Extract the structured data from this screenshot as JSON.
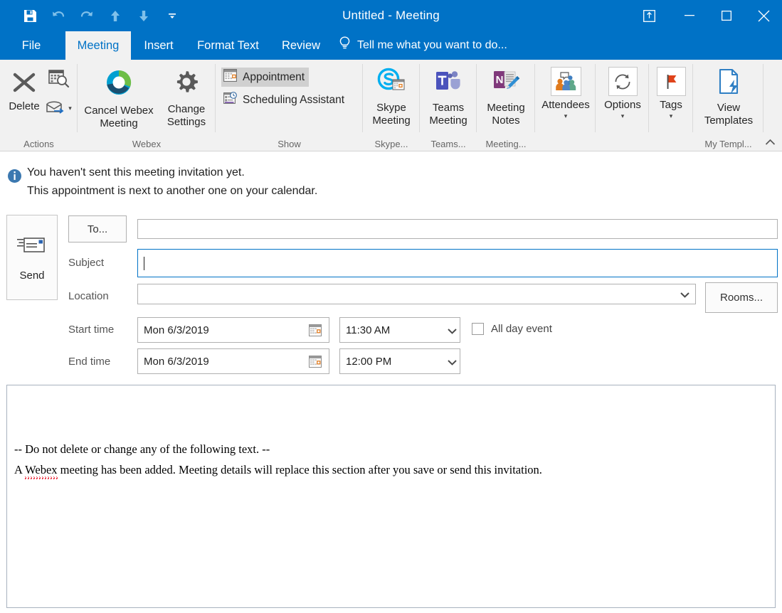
{
  "window": {
    "title": "Untitled - Meeting",
    "quick_access": [
      {
        "name": "save-icon",
        "label": "Save"
      },
      {
        "name": "undo-icon",
        "label": "Undo"
      },
      {
        "name": "redo-icon",
        "label": "Redo"
      },
      {
        "name": "previous-item-icon",
        "label": "Previous Item"
      },
      {
        "name": "next-item-icon",
        "label": "Next Item"
      },
      {
        "name": "customize-quick-access-toolbar-icon",
        "label": "Customize Quick Access Toolbar"
      }
    ],
    "controls": [
      {
        "name": "pin-ribbon-button",
        "label": "Ribbon Display Options"
      },
      {
        "name": "minimize-button",
        "label": "Minimize"
      },
      {
        "name": "maximize-button",
        "label": "Maximize"
      },
      {
        "name": "close-button",
        "label": "Close"
      }
    ],
    "accent_color": "#0072c6"
  },
  "tabs": [
    {
      "label": "File",
      "active": false
    },
    {
      "label": "Meeting",
      "active": true
    },
    {
      "label": "Insert",
      "active": false
    },
    {
      "label": "Format Text",
      "active": false
    },
    {
      "label": "Review",
      "active": false
    }
  ],
  "tell_me": {
    "placeholder": "Tell me what you want to do...",
    "icon": "lightbulb-icon"
  },
  "ribbon": {
    "groups": [
      {
        "id": "actions",
        "label": "Actions",
        "buttons": [
          {
            "id": "delete",
            "label": "Delete",
            "icon": "delete-x-icon"
          },
          {
            "id": "forward",
            "label": "",
            "icon": "forward-envelope-icon",
            "has_dropdown": true
          }
        ]
      },
      {
        "id": "webex",
        "label": "Webex",
        "buttons": [
          {
            "id": "cancel-webex-meeting",
            "label": "Cancel Webex\nMeeting",
            "line1": "Cancel Webex",
            "line2": "Meeting",
            "icon": "webex-circle-icon"
          },
          {
            "id": "change-settings",
            "label": "Change Settings",
            "line1": "Change",
            "line2": "Settings",
            "icon": "gear-icon"
          }
        ]
      },
      {
        "id": "show",
        "label": "Show",
        "items": [
          {
            "id": "appointment",
            "label": "Appointment",
            "icon": "appointment-calendar-icon",
            "selected": true
          },
          {
            "id": "scheduling-assistant",
            "label": "Scheduling Assistant",
            "icon": "scheduling-assistant-icon",
            "selected": false
          }
        ]
      },
      {
        "id": "skype",
        "label": "Skype...",
        "buttons": [
          {
            "id": "skype-meeting",
            "line1": "Skype",
            "line2": "Meeting",
            "icon": "skype-meeting-icon"
          }
        ]
      },
      {
        "id": "teams",
        "label": "Teams...",
        "buttons": [
          {
            "id": "teams-meeting",
            "line1": "Teams",
            "line2": "Meeting",
            "icon": "teams-meeting-icon"
          }
        ]
      },
      {
        "id": "meeting-notes-group",
        "label": "Meeting...",
        "buttons": [
          {
            "id": "meeting-notes",
            "line1": "Meeting",
            "line2": "Notes",
            "icon": "onenote-meeting-notes-icon"
          }
        ]
      },
      {
        "id": "attendees",
        "label": "",
        "buttons": [
          {
            "id": "attendees",
            "line1": "Attendees",
            "line2": "",
            "icon": "attendees-people-icon",
            "has_dropdown": true
          }
        ]
      },
      {
        "id": "options",
        "label": "",
        "buttons": [
          {
            "id": "options",
            "line1": "Options",
            "line2": "",
            "icon": "recurrence-refresh-icon",
            "has_dropdown": true
          }
        ]
      },
      {
        "id": "tags",
        "label": "",
        "buttons": [
          {
            "id": "tags",
            "line1": "Tags",
            "line2": "",
            "icon": "red-flag-icon",
            "has_dropdown": true
          }
        ]
      },
      {
        "id": "my-templates",
        "label": "My Templ...",
        "buttons": [
          {
            "id": "view-templates",
            "line1": "View",
            "line2": "Templates",
            "icon": "view-templates-icon"
          }
        ]
      }
    ],
    "collapse_label": "^"
  },
  "info_bar": {
    "icon": "info-icon",
    "line1": "You haven't sent this meeting invitation yet.",
    "line2": "This appointment is next to another one on your calendar."
  },
  "form": {
    "send_button": {
      "label": "Send",
      "icon": "send-envelope-icon"
    },
    "to_button": {
      "label": "To..."
    },
    "to_field": {
      "value": "",
      "placeholder": ""
    },
    "subject": {
      "label": "Subject",
      "value": "",
      "focused": true
    },
    "location": {
      "label": "Location",
      "value": "",
      "has_dropdown": true
    },
    "rooms_button": {
      "label": "Rooms..."
    },
    "start_time": {
      "label": "Start time",
      "date": "Mon 6/3/2019",
      "time": "11:30 AM"
    },
    "end_time": {
      "label": "End time",
      "date": "Mon 6/3/2019",
      "time": "12:00 PM"
    },
    "all_day_event": {
      "label": "All day event",
      "checked": false
    }
  },
  "body": {
    "line1": "-- Do not delete or change any of the following text. --",
    "line2_a": "A ",
    "line2_b": "Webex",
    "line2_c": " meeting has been added. Meeting details will replace this section after you save or send this invitation.",
    "line2_full": "A Webex meeting has been added. Meeting details will replace this section after you save or send this invitation."
  }
}
